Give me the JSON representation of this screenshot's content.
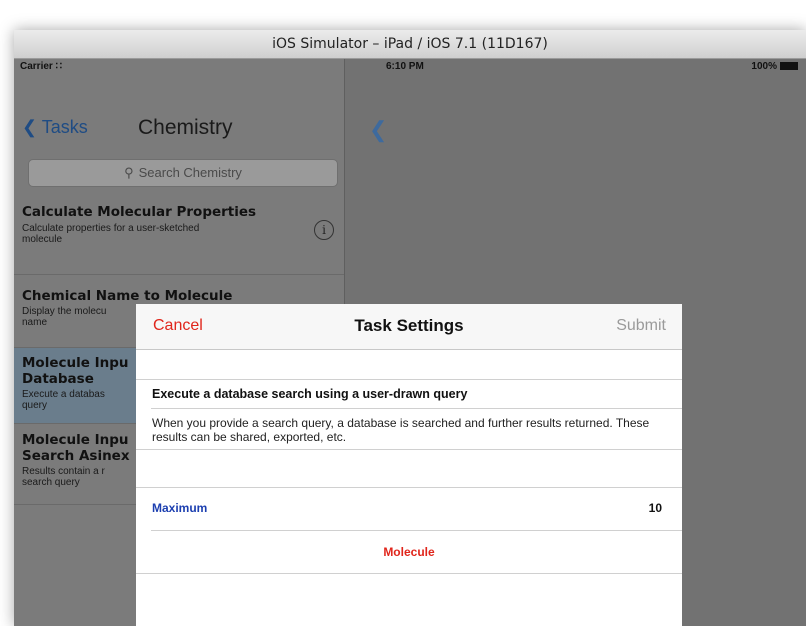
{
  "window": {
    "title": "iOS Simulator – iPad / iOS 7.1 (11D167)"
  },
  "status_bar": {
    "carrier": "Carrier",
    "time": "6:10 PM",
    "battery": "100%"
  },
  "master": {
    "back_label": "Tasks",
    "title": "Chemistry",
    "search_placeholder": "Search Chemistry",
    "items": [
      {
        "title": "Calculate Molecular Properties",
        "subtitle_1": "Calculate properties for a user-sketched",
        "subtitle_2": "molecule"
      },
      {
        "title": "Chemical Name to Molecule",
        "subtitle_1": "Display the molecu",
        "subtitle_2": "name"
      },
      {
        "title_1": "Molecule Inpu",
        "title_2": "Database",
        "subtitle_1": "Execute a databas",
        "subtitle_2": "query"
      },
      {
        "title_1": "Molecule Inpu",
        "title_2": "Search Asinex",
        "subtitle_1": "Results contain a r",
        "subtitle_2": "search query"
      }
    ]
  },
  "modal": {
    "cancel_label": "Cancel",
    "title": "Task Settings",
    "submit_label": "Submit",
    "description_title": "Execute a database search using a user-drawn query",
    "description_text": "When you provide a search query, a database is searched and further results returned. These results can be shared, exported, etc.",
    "maximum_label": "Maximum",
    "maximum_value": "10",
    "molecule_label": "Molecule"
  },
  "colors": {
    "accent_red": "#e0251b",
    "link_blue": "#1c3fb0",
    "disabled_gray": "#9a9a9a"
  }
}
